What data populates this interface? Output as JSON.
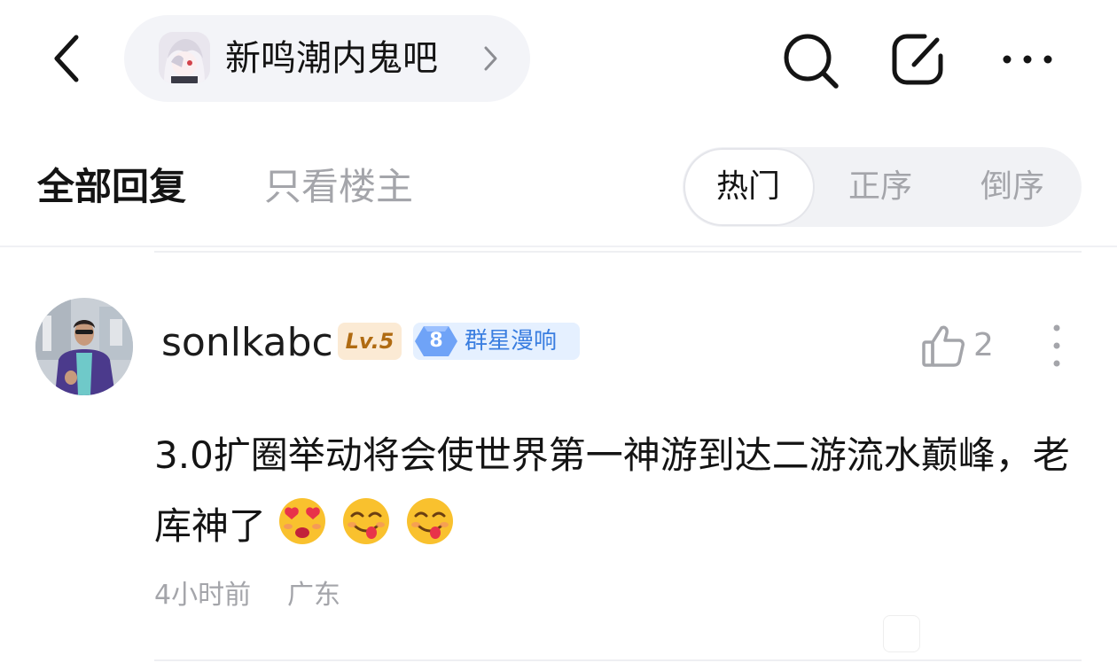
{
  "header": {
    "forum_name": "新鸣潮内鬼吧",
    "icons": [
      "back-icon",
      "chevron-right-icon",
      "search-icon",
      "edit-icon",
      "more-icon"
    ]
  },
  "tabs": {
    "all_replies": "全部回复",
    "host_only": "只看楼主"
  },
  "sort": {
    "options": [
      "热门",
      "正序",
      "倒序"
    ],
    "selected": "热门"
  },
  "comment": {
    "username": "sonlkabc",
    "level": "Lv.5",
    "fans_level": "8",
    "fans_group": "群星漫响",
    "like_count": "2",
    "text": "3.0扩圈举动将会使世界第一神游到达二游流水巅峰，老库神了",
    "emojis": [
      "heart-eyes-emoji",
      "yum-emoji",
      "yum-emoji"
    ],
    "time": "4小时前",
    "location": "广东"
  },
  "colors": {
    "primary_text": "#141414",
    "secondary_text": "#a4a5aa",
    "pill_bg": "#f3f4f8",
    "level_badge_bg": "#fbead4",
    "level_badge_text": "#b06b12",
    "fans_badge_bg": "#e5f0ff",
    "fans_badge_text": "#3a7ee0"
  }
}
